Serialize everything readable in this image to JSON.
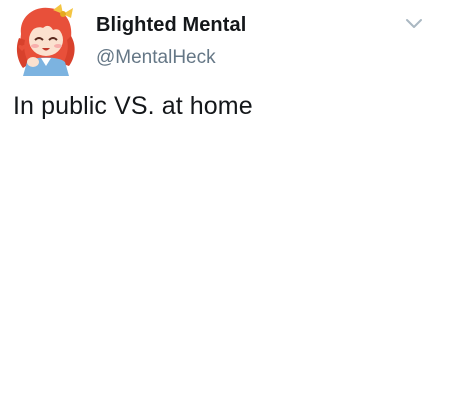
{
  "tweet": {
    "author": {
      "display_name": "Blighted Mental",
      "handle": "@MentalHeck",
      "avatar_icon": "anime-girl-avatar-icon"
    },
    "menu_icon": "chevron-down-icon",
    "text": "In public VS. at home"
  },
  "colors": {
    "name": "#14171a",
    "handle": "#657786",
    "text": "#14171a",
    "caret": "#aab8c2",
    "avatar_hair": "#e8503a",
    "avatar_bow": "#f4c542",
    "avatar_shirt": "#7cb3e0"
  }
}
